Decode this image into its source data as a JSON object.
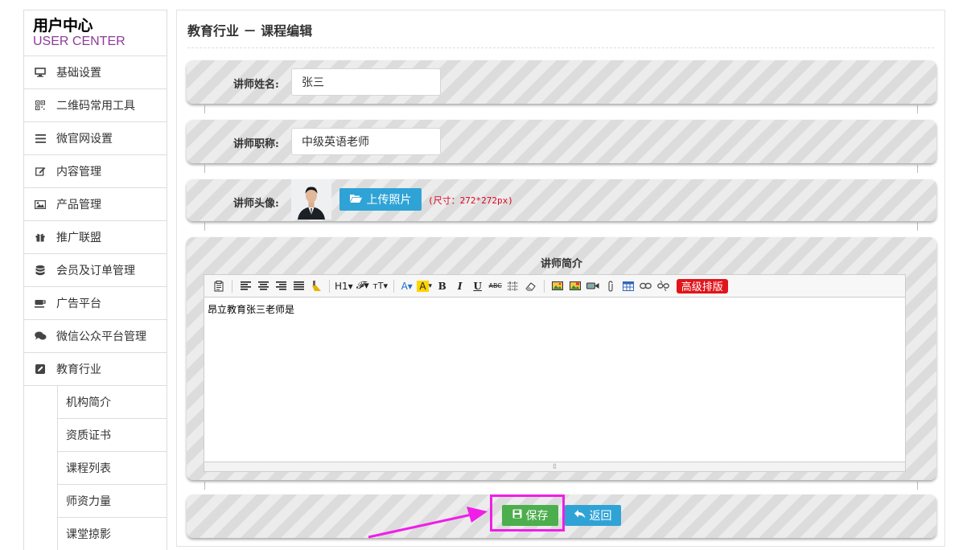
{
  "brand": {
    "cn": "用户中心",
    "en": "USER CENTER"
  },
  "sidebar": {
    "items": [
      {
        "label": "基础设置",
        "icon": "monitor-icon"
      },
      {
        "label": "二维码常用工具",
        "icon": "qrcode-icon"
      },
      {
        "label": "微官网设置",
        "icon": "list-icon"
      },
      {
        "label": "内容管理",
        "icon": "edit-icon"
      },
      {
        "label": "产品管理",
        "icon": "image-icon"
      },
      {
        "label": "推广联盟",
        "icon": "gift-icon"
      },
      {
        "label": "会员及订单管理",
        "icon": "database-icon"
      },
      {
        "label": "广告平台",
        "icon": "coffee-icon"
      },
      {
        "label": "微信公众平台管理",
        "icon": "comments-icon"
      },
      {
        "label": "教育行业",
        "icon": "pencil-square-icon"
      }
    ],
    "sub_items": [
      {
        "label": "机构简介"
      },
      {
        "label": "资质证书"
      },
      {
        "label": "课程列表"
      },
      {
        "label": "师资力量"
      },
      {
        "label": "课堂掠影"
      }
    ]
  },
  "main": {
    "title": "教育行业 － 课程编辑",
    "teacher_name": {
      "label": "讲师姓名:",
      "value": "张三"
    },
    "teacher_title": {
      "label": "讲师职称:",
      "value": "中级英语老师"
    },
    "teacher_avatar": {
      "label": "讲师头像:",
      "upload_label": "上传照片",
      "size_note": "(尺寸：272*272px)"
    },
    "intro": {
      "label": "讲师简介",
      "content": "昂立教育张三老师是",
      "advanced_label": "高级排版",
      "toolbar": [
        "source-icon",
        "align-left-icon",
        "align-center-icon",
        "align-right-icon",
        "align-justify-icon",
        "format-brush-icon",
        "heading-icon",
        "font-family-icon",
        "font-size-icon",
        "font-color-icon",
        "highlight-icon",
        "bold-icon",
        "italic-icon",
        "underline-icon",
        "strikethrough-icon",
        "table-grid-icon",
        "eraser-icon",
        "insert-image-icon",
        "multi-image-icon",
        "video-icon",
        "attachment-icon",
        "table-icon",
        "link-icon",
        "unlink-icon"
      ]
    },
    "buttons": {
      "save": "保存",
      "back": "返回"
    }
  },
  "colors": {
    "accent_blue": "#2fa3d6",
    "save_green": "#4cae4c",
    "highlight_magenta": "#f01ee8",
    "brand_purple": "#8e3a9a",
    "warning_red": "#e0001b"
  }
}
